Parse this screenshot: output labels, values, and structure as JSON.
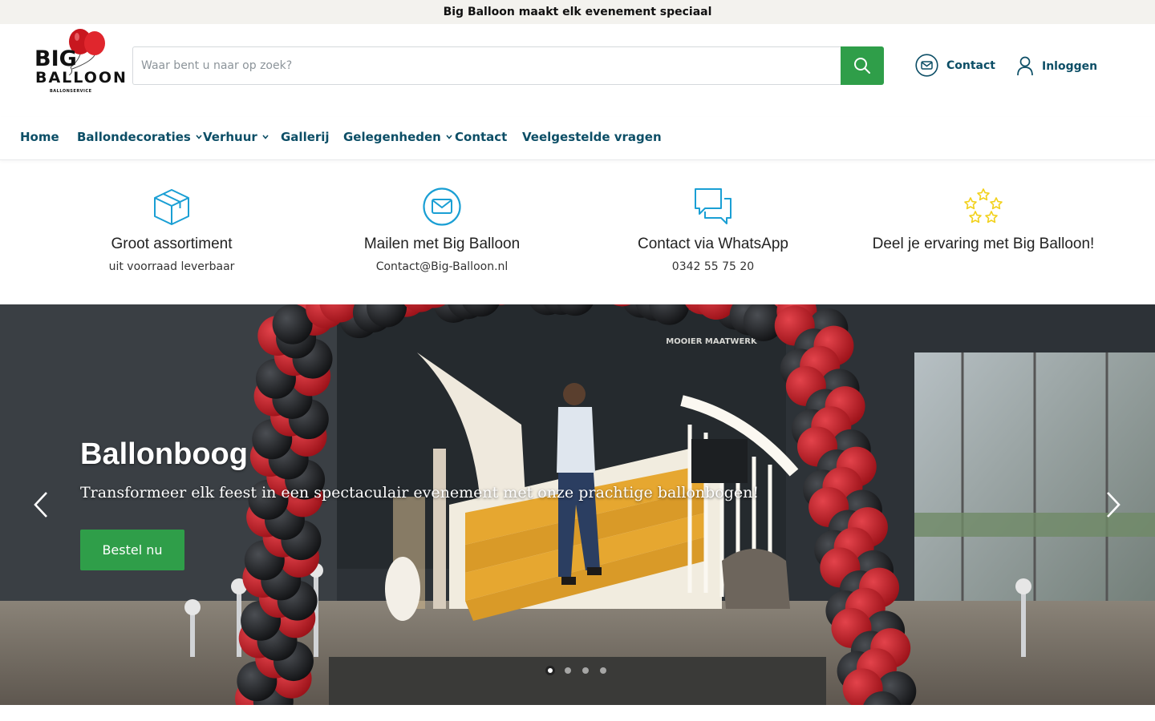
{
  "announcement": "Big Balloon maakt elk evenement speciaal",
  "logo": {
    "line1": "BIG",
    "line2": "BALLOON",
    "line3": "BALLONSERVICE",
    "icon": "red-balloons-logo"
  },
  "search": {
    "placeholder": "Waar bent u naar op zoek?",
    "value": "",
    "button_icon": "search-icon"
  },
  "header_links": [
    {
      "label": "Contact",
      "icon": "mail-circle-icon"
    },
    {
      "label": "Inloggen",
      "icon": "user-icon"
    }
  ],
  "nav": [
    {
      "label": "Home",
      "dropdown": false
    },
    {
      "label": "Ballondecoraties",
      "dropdown": true
    },
    {
      "label": "Verhuur",
      "dropdown": true
    },
    {
      "label": "Gallerij",
      "dropdown": false
    },
    {
      "label": "Gelegenheden",
      "dropdown": true
    },
    {
      "label": "Contact",
      "dropdown": false
    },
    {
      "label": "Veelgestelde vragen",
      "dropdown": false
    }
  ],
  "features": [
    {
      "title": "Groot assortiment",
      "subtitle": "uit voorraad leverbaar",
      "icon": "box-icon"
    },
    {
      "title": "Mailen met Big Balloon",
      "subtitle": "Contact@Big-Balloon.nl",
      "icon": "mail-circle-icon"
    },
    {
      "title": "Contact via WhatsApp",
      "subtitle": "0342 55 75 20",
      "icon": "chat-bubbles-icon"
    },
    {
      "title": "Deel je ervaring met Big Balloon!",
      "subtitle": "",
      "icon": "stars-icon"
    }
  ],
  "hero": {
    "title": "Ballonboog",
    "subtitle": "Transformeer elk feest in een spectaculair evenement met onze prachtige ballonbogen!",
    "button": "Bestel nu",
    "wall_sign": "MOOIER MAATWERK",
    "slide_count": 4,
    "active_slide": 1
  },
  "colors": {
    "brand_blue": "#0c4e66",
    "accent_green": "#2f9e49",
    "icon_blue": "#1a9fd4",
    "star_yellow": "#f2d11b",
    "balloon_red": "#c0262e"
  }
}
